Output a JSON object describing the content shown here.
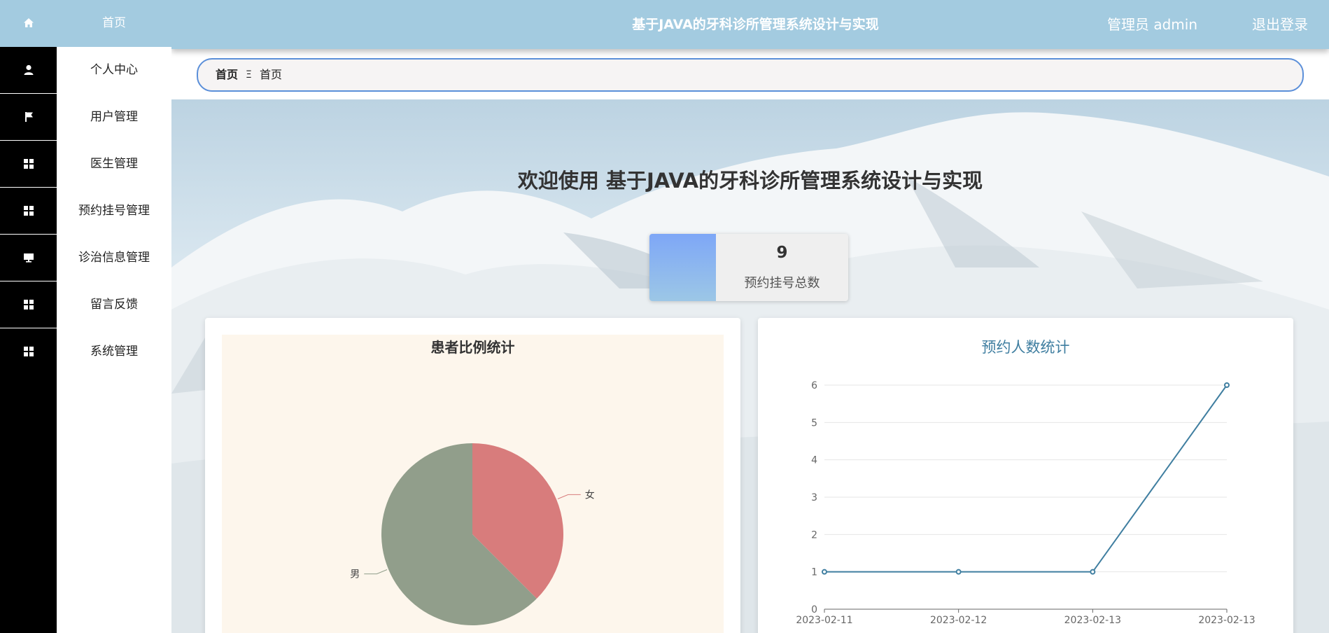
{
  "sidebar": {
    "items": [
      {
        "label": "首页",
        "icon": "home-icon"
      },
      {
        "label": "个人中心",
        "icon": "user-icon"
      },
      {
        "label": "用户管理",
        "icon": "flag-icon"
      },
      {
        "label": "医生管理",
        "icon": "grid-icon"
      },
      {
        "label": "预约挂号管理",
        "icon": "grid-icon"
      },
      {
        "label": "诊治信息管理",
        "icon": "monitor-icon"
      },
      {
        "label": "留言反馈",
        "icon": "grid-icon"
      },
      {
        "label": "系统管理",
        "icon": "grid-icon"
      }
    ]
  },
  "header": {
    "title": "基于JAVA的牙科诊所管理系统设计与实现",
    "user": "管理员 admin",
    "logout": "退出登录"
  },
  "breadcrumb": {
    "home": "首页",
    "separator": "Ξ",
    "current": "首页"
  },
  "main": {
    "welcome": "欢迎使用 基于JAVA的牙科诊所管理系统设计与实现",
    "stat": {
      "value": "9",
      "label": "预约挂号总数"
    }
  },
  "colors": {
    "header": "#a3cbe0",
    "sidebar_icon_bg": "#000000",
    "breadcrumb_border": "#5b8fd9",
    "pie_female": "#d87c7c",
    "pie_male": "#919e8b",
    "line": "#3f7ea0"
  },
  "chart_data": [
    {
      "type": "pie",
      "title": "患者比例统计",
      "labels": [
        "女",
        "男"
      ],
      "values": [
        3,
        5
      ]
    },
    {
      "type": "line",
      "title": "预约人数统计",
      "x": [
        "2023-02-11",
        "2023-02-12",
        "2023-02-13",
        "2023-02-13"
      ],
      "y": [
        1,
        1,
        1,
        6
      ],
      "yticks": [
        "0",
        "1",
        "2",
        "3",
        "4",
        "5",
        "6"
      ],
      "ylim": [
        0,
        6
      ],
      "grid": true
    }
  ]
}
